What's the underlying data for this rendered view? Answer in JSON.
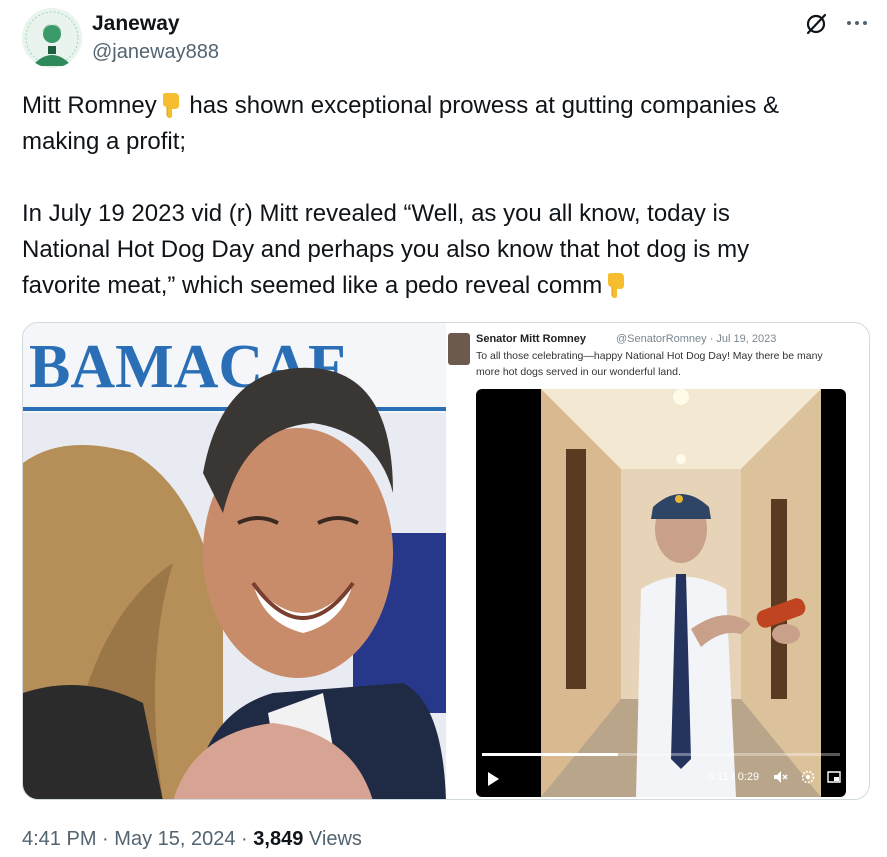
{
  "author": {
    "name": "Janeway",
    "handle": "@janeway888"
  },
  "tweet": {
    "line1_a": "Mitt Romney",
    "line1_b": " has shown exceptional prowess at gutting companies &",
    "line2": "making a profit;",
    "line3": "In July 19 2023 vid (r) Mitt revealed “Well, as you all know, today is",
    "line4": "National Hot Dog Day and perhaps you also know that hot dog is my",
    "line5": "favorite meat,” which seemed like a pedo reveal comm"
  },
  "media": {
    "left_sign_text": "BAMACAF",
    "embed": {
      "name": "Senator Mitt Romney",
      "handle_date": "@SenatorRomney · Jul 19, 2023",
      "text_line1": "To all those celebrating—happy National Hot Dog Day! May there be many",
      "text_line2": "more hot dogs served in our wonderful land."
    },
    "video": {
      "time": "0:11 / 0:29",
      "progress": 0.38
    }
  },
  "footer": {
    "time": "4:41 PM",
    "date": "May 15, 2024",
    "views_count": "3,849",
    "views_label": "Views",
    "sep": "·"
  },
  "icons": {
    "grok": "grok-icon",
    "more": "more-icon",
    "point_down": "backhand-index-pointing-down-icon"
  }
}
